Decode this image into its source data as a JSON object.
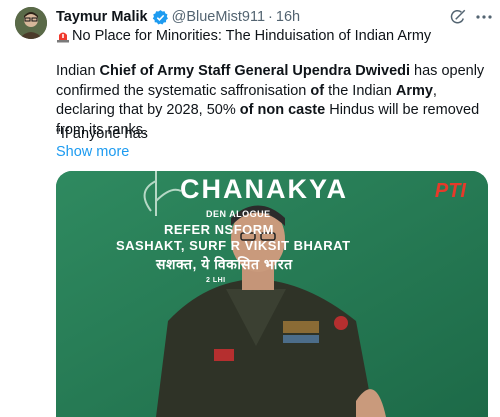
{
  "tweet": {
    "author_name": "Taymur Malik",
    "handle": "@BlueMist911",
    "separator": "·",
    "time": "16h",
    "headline": "No Place for Minorities: The Hinduisation of Indian Army",
    "body_parts": [
      {
        "text": "Indian ",
        "bold": false
      },
      {
        "text": "Chief of Army Staff General Upendra Dwivedi",
        "bold": true
      },
      {
        "text": " has openly confirmed the systematic saffronisation ",
        "bold": false
      },
      {
        "text": "of",
        "bold": true
      },
      {
        "text": " the Indian ",
        "bold": false
      },
      {
        "text": "Army",
        "bold": true
      },
      {
        "text": ", declaring that by 2028, 50% ",
        "bold": false
      },
      {
        "text": "of non caste",
        "bold": true
      },
      {
        "text": " Hindus will be removed from its ranks.",
        "bold": false
      }
    ],
    "quote_start": "“If anyone has",
    "show_more": "Show more"
  },
  "media": {
    "banner_title": "CHANAKYA",
    "banner_sub": "DEN         ALOGUE",
    "banner_line1": "REFER                  NSFORM",
    "banner_line2": "SASHAKT, SURF             R VIKSIT BHARAT",
    "banner_line3": "सशक्त, ये           विकसित भारत",
    "banner_small": "2            LHI",
    "watermark": "PTI"
  },
  "colors": {
    "link": "#1d9bf0",
    "verified": "#1d9bf0",
    "banner_green": "#247a55",
    "uniform": "#2f3327"
  },
  "icons": [
    "verified-badge-icon",
    "grok-icon",
    "more-options-icon",
    "siren-emoji-icon"
  ]
}
